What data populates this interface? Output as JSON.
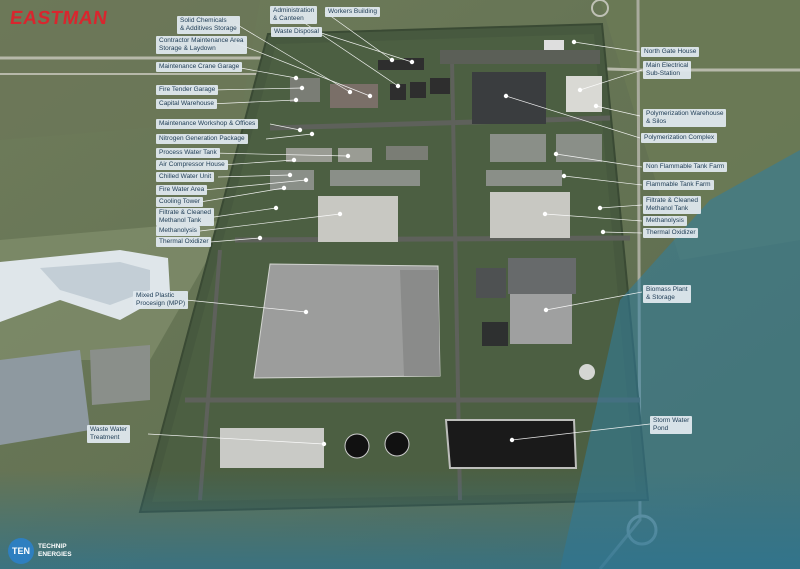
{
  "brand": {
    "name": "EASTMAN",
    "color": "#d8262e"
  },
  "partner": {
    "badge": "TEN",
    "line1": "TECHNIP",
    "line2": "ENERGIES",
    "color": "#2e7fc0"
  },
  "labels": [
    {
      "id": "solid-chemicals",
      "text": "Solid Chemicals\n& Additives Storage"
    },
    {
      "id": "administration",
      "text": "Administration\n& Canteen"
    },
    {
      "id": "workers-building",
      "text": "Workers Building"
    },
    {
      "id": "waste-disposal",
      "text": "Waste Disposal"
    },
    {
      "id": "contractor-area",
      "text": "Contractor Maintenance Area\nStorage & Laydown"
    },
    {
      "id": "north-gate",
      "text": "North Gate House"
    },
    {
      "id": "maintenance-crane",
      "text": "Maintenance Crane Garage"
    },
    {
      "id": "main-electrical",
      "text": "Main Electrical\nSub-Station"
    },
    {
      "id": "fire-tender",
      "text": "Fire Tender Garage"
    },
    {
      "id": "capital-warehouse",
      "text": "Capital Warehouse"
    },
    {
      "id": "polymerization-warehouse",
      "text": "Polymerization Warehouse\n& Silos"
    },
    {
      "id": "maintenance-workshop",
      "text": "Maintenance Workshop & Offices"
    },
    {
      "id": "polymerization-complex",
      "text": "Polymerization Complex"
    },
    {
      "id": "nitrogen-generation",
      "text": "Nitrogen Generation Package"
    },
    {
      "id": "process-water",
      "text": "Process Water Tank"
    },
    {
      "id": "non-flammable",
      "text": "Non Flammable Tank Farm"
    },
    {
      "id": "air-compressor",
      "text": "Air Compressor House"
    },
    {
      "id": "chilled-water",
      "text": "Chilled Water Unit"
    },
    {
      "id": "flammable",
      "text": "Flammable Tank Farm"
    },
    {
      "id": "fire-water",
      "text": "Fire Water Area"
    },
    {
      "id": "cooling-tower",
      "text": "Cooling Tower"
    },
    {
      "id": "filtrate-left",
      "text": "Filtrate & Cleaned\nMethanol Tank"
    },
    {
      "id": "filtrate-right",
      "text": "Filtrate & Cleaned\nMethanol Tank"
    },
    {
      "id": "methanolysis-left",
      "text": "Methanolysis"
    },
    {
      "id": "methanolysis-right",
      "text": "Methanolysis"
    },
    {
      "id": "thermal-left",
      "text": "Thermal Oxidizer"
    },
    {
      "id": "thermal-right",
      "text": "Thermal Oxidizer"
    },
    {
      "id": "mixed-plastic",
      "text": "Mixed Plastic\nProcesign (MPP)"
    },
    {
      "id": "biomass",
      "text": "Biomass Plant\n& Storage"
    },
    {
      "id": "waste-water",
      "text": "Waste Water\nTreatment"
    },
    {
      "id": "storm-water",
      "text": "Storm Water\nPond"
    }
  ],
  "colors": {
    "site": "#495e3c",
    "roads": "#5b5d57",
    "label_bg": "#dfe8ee",
    "label_text": "#1d3b54",
    "overlay": "#2f7ea0"
  }
}
